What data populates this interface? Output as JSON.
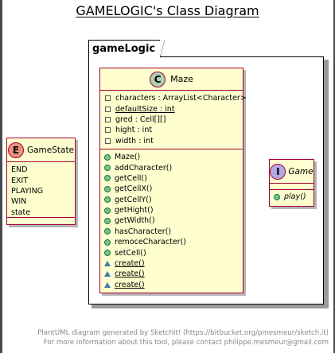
{
  "title": "GAMELOGIC's Class Diagram",
  "package": {
    "name": "gameLogic"
  },
  "maze": {
    "stereotype": "C",
    "name": "Maze",
    "fields": [
      {
        "text": "characters : ArrayList<Character>",
        "static": false
      },
      {
        "text": "defaultSize : int",
        "static": true
      },
      {
        "text": "gred : Cell[][]",
        "static": false
      },
      {
        "text": "hight : int",
        "static": false
      },
      {
        "text": "width : int",
        "static": false
      }
    ],
    "methods": [
      {
        "text": "Maze()",
        "visibility": "public"
      },
      {
        "text": "addCharacter()",
        "visibility": "public"
      },
      {
        "text": "getCell()",
        "visibility": "public"
      },
      {
        "text": "getCellX()",
        "visibility": "public"
      },
      {
        "text": "getCellY()",
        "visibility": "public"
      },
      {
        "text": "getHight()",
        "visibility": "public"
      },
      {
        "text": "getWidth()",
        "visibility": "public"
      },
      {
        "text": "hasCharacter()",
        "visibility": "public"
      },
      {
        "text": "remoceCharacter()",
        "visibility": "public"
      },
      {
        "text": "setCell()",
        "visibility": "public"
      },
      {
        "text": "create()",
        "visibility": "package",
        "static": true
      },
      {
        "text": "create()",
        "visibility": "package",
        "static": true
      },
      {
        "text": "create()",
        "visibility": "package",
        "static": true
      }
    ]
  },
  "gamestate": {
    "stereotype": "E",
    "name": "GameState",
    "values": [
      "END",
      "EXIT",
      "PLAYING",
      "WIN",
      "state"
    ]
  },
  "game": {
    "stereotype": "I",
    "name": "Game",
    "methods": [
      {
        "text": "play()",
        "visibility": "public",
        "abstract": true
      }
    ]
  },
  "footer": {
    "line1": "PlantUML diagram generated by SketchIt! (https://bitbucket.org/pmesmeur/sketch.it)",
    "line2": "For more information about this tool, please contact philippe.mesmeur@gmail.com"
  },
  "colors": {
    "class_fill": "#fefece",
    "class_border": "#a80036",
    "class_circle": "#add1b2",
    "enum_circle": "#eb937f",
    "interface_circle": "#b4a7e5",
    "method_public": "#84be84",
    "method_package": "#4177af"
  }
}
